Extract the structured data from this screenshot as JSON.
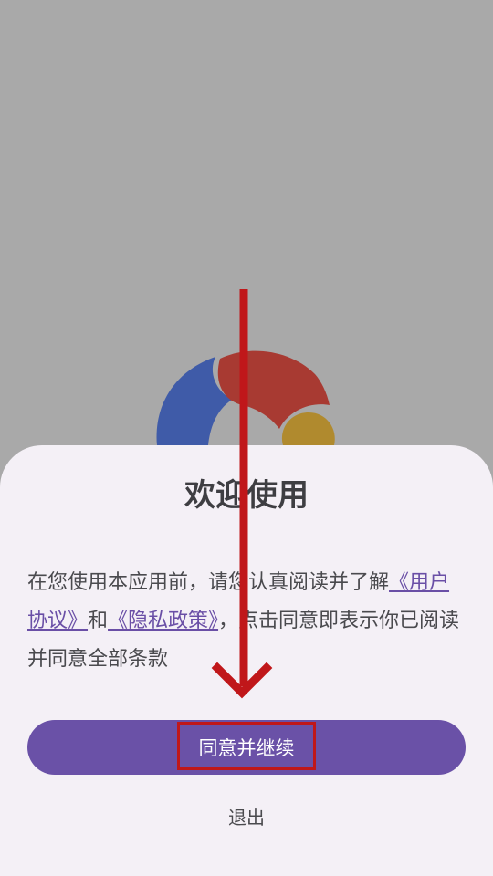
{
  "dialog": {
    "title": "欢迎使用",
    "text_before": "在您使用本应用前，请您认真阅读并了解",
    "user_agreement_link": "《用户协议》",
    "text_and": "和",
    "privacy_policy_link": "《隐私政策》",
    "text_after": "，点击同意即表示你已阅读并同意全部条款",
    "agree_button": "同意并继续",
    "exit_button": "退出"
  },
  "colors": {
    "overlay_background": "#a9a9a9",
    "sheet_background": "#f4f0f6",
    "accent": "#6a51a7",
    "annotation_red": "#c0171a",
    "logo_blue": "#3f5ba8",
    "logo_red": "#a83a32",
    "logo_yellow": "#b08a2e"
  },
  "icons": {
    "logo": "app-logo-icon",
    "annotation": "down-arrow-annotation"
  }
}
